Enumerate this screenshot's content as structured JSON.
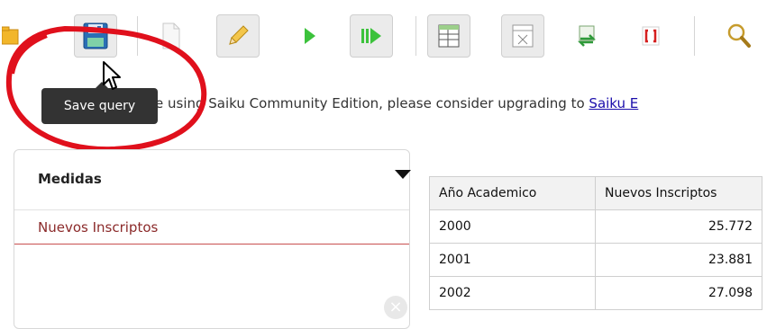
{
  "toolbar": {
    "buttons": [
      {
        "name": "open-query-button",
        "icon": "folder-icon"
      },
      {
        "name": "save-query-button",
        "icon": "floppy-disk-icon"
      },
      {
        "name": "new-query-button",
        "icon": "blank-page-icon"
      },
      {
        "name": "edit-query-button",
        "icon": "pencil-icon"
      },
      {
        "name": "run-query-button",
        "icon": "play-icon"
      },
      {
        "name": "automatic-execution-button",
        "icon": "play-bars-icon"
      },
      {
        "name": "toggle-fields-button",
        "icon": "table-add-icon"
      },
      {
        "name": "toggle-sidebar-button",
        "icon": "table-delete-icon"
      },
      {
        "name": "swap-axis-button",
        "icon": "swap-arrows-icon"
      },
      {
        "name": "mdx-button",
        "icon": "brackets-icon"
      },
      {
        "name": "explain-button",
        "icon": "magnifier-icon"
      }
    ]
  },
  "tooltip": {
    "text": "Save query"
  },
  "notice": {
    "text": "e using Saiku Community Edition, please consider upgrading to ",
    "link": "Saiku E"
  },
  "measures_panel": {
    "title": "Medidas",
    "items": [
      "Nuevos Inscriptos"
    ]
  },
  "results_table": {
    "columns": [
      "Año Academico",
      "Nuevos Inscriptos"
    ],
    "rows": [
      [
        "2000",
        "25.772"
      ],
      [
        "2001",
        "23.881"
      ],
      [
        "2002",
        "27.098"
      ]
    ]
  },
  "colors": {
    "annotation_circle": "#e0101c",
    "measure_item_text": "#8b2a2a",
    "link": "#1a0dab",
    "tooltip_bg": "#333333"
  }
}
